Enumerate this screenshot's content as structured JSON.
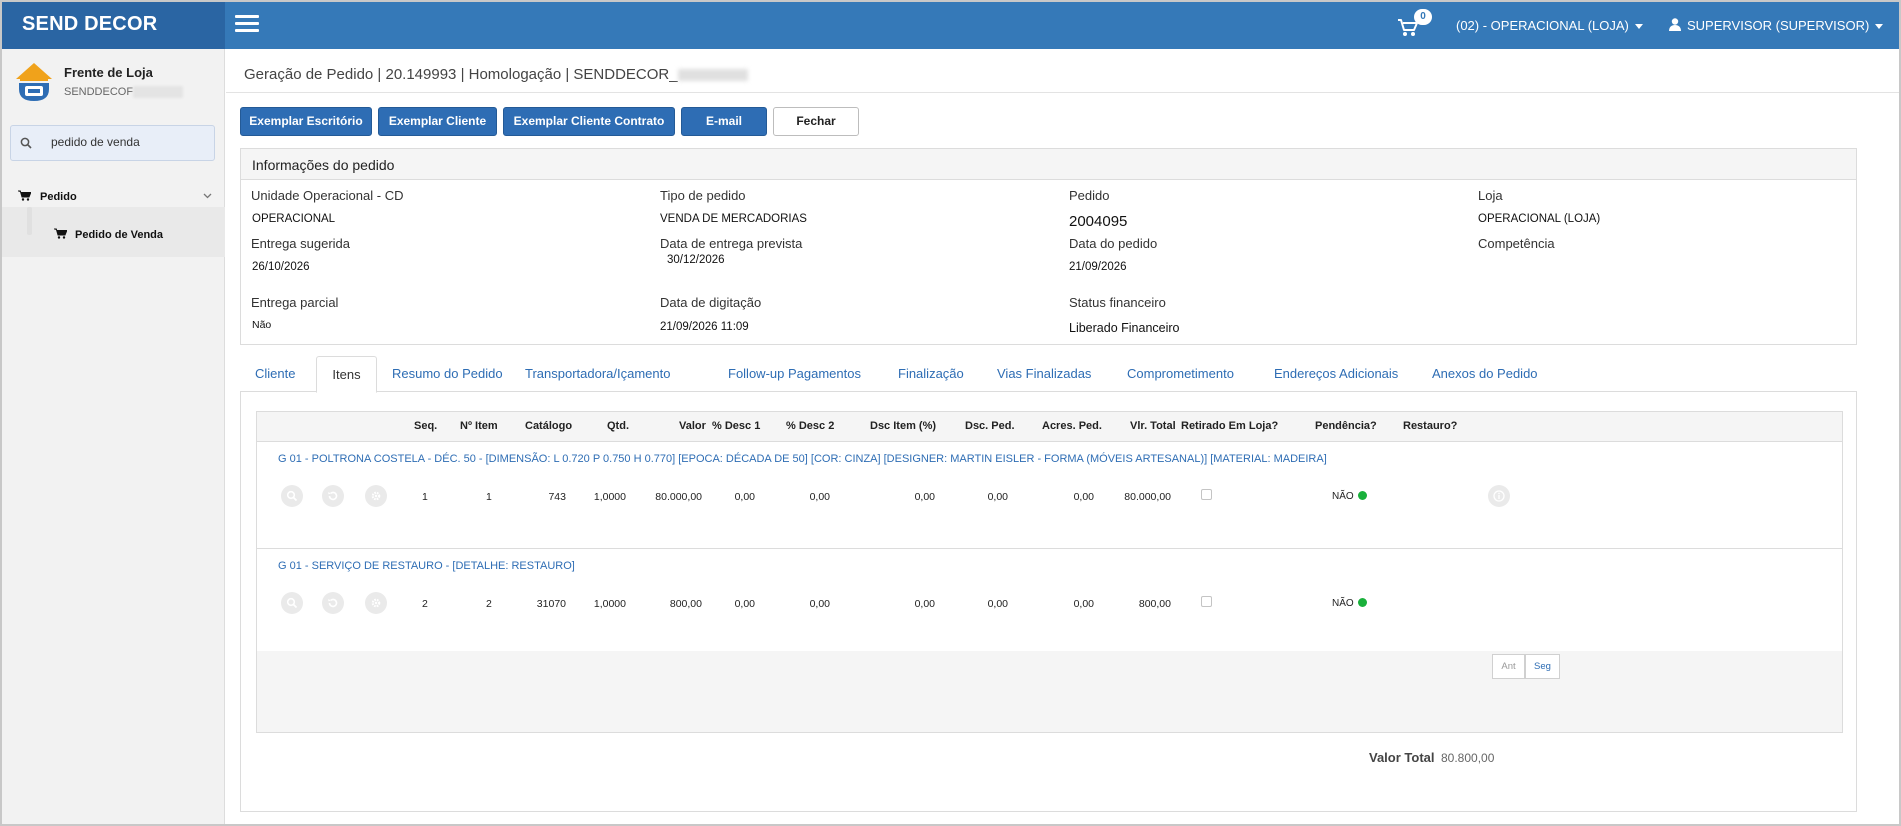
{
  "app": {
    "brand": "SEND DECOR"
  },
  "topbar": {
    "cart_count": "0",
    "unit_menu": "(02) - OPERACIONAL (LOJA)",
    "user_menu": "SUPERVISOR (SUPERVISOR)"
  },
  "sidebar": {
    "shop_title": "Frente de Loja",
    "shop_sub": "SENDDECOF",
    "search_value": "pedido de venda",
    "nav": [
      {
        "label": "Pedido"
      },
      {
        "label": "Pedido de Venda"
      }
    ]
  },
  "header": {
    "breadcrumb": "Geração de Pedido | 20.149993 | Homologação | SENDDECOR_"
  },
  "toolbar": {
    "btn_office": "Exemplar Escritório",
    "btn_client": "Exemplar Cliente",
    "btn_contract": "Exemplar Cliente Contrato",
    "btn_email": "E-mail",
    "btn_close": "Fechar"
  },
  "info": {
    "title": "Informações do pedido",
    "fields": [
      {
        "label": "Unidade Operacional - CD",
        "value": "OPERACIONAL"
      },
      {
        "label": "Tipo de pedido",
        "value": "VENDA DE MERCADORIAS"
      },
      {
        "label": "Pedido",
        "value": "2004095"
      },
      {
        "label": "Loja",
        "value": "OPERACIONAL (LOJA)"
      },
      {
        "label": "Entrega sugerida",
        "value": "26/10/2026"
      },
      {
        "label": "Data de entrega prevista",
        "value": "30/12/2026"
      },
      {
        "label": "Data do pedido",
        "value": "21/09/2026"
      },
      {
        "label": "Competência",
        "value": ""
      },
      {
        "label": "Entrega parcial",
        "value": "Não"
      },
      {
        "label": "Data de digitação",
        "value": "21/09/2026 11:09"
      },
      {
        "label": "Status financeiro",
        "value": "Liberado Financeiro"
      }
    ]
  },
  "tabs": [
    {
      "label": "Cliente"
    },
    {
      "label": "Itens"
    },
    {
      "label": "Resumo do Pedido"
    },
    {
      "label": "Transportadora/Içamento"
    },
    {
      "label": "Follow-up Pagamentos"
    },
    {
      "label": "Finalização"
    },
    {
      "label": "Vias Finalizadas"
    },
    {
      "label": "Comprometimento"
    },
    {
      "label": "Endereços Adicionais"
    },
    {
      "label": "Anexos do Pedido"
    }
  ],
  "grid": {
    "columns": [
      "Seq.",
      "Nº Item",
      "Catálogo",
      "Qtd.",
      "Valor",
      "% Desc 1",
      "% Desc 2",
      "Dsc Item (%)",
      "Dsc. Ped.",
      "Acres. Ped.",
      "Vlr. Total",
      "Retirado Em Loja?",
      "Pendência?",
      "Restauro?"
    ],
    "rows": [
      {
        "description": "G 01 - POLTRONA COSTELA - DÉC. 50 - [DIMENSÃO: L 0.720 P 0.750 H 0.770] [EPOCA: DÉCADA DE 50] [COR: CINZA] [DESIGNER: MARTIN EISLER - FORMA (MÓVEIS ARTESANAL)] [MATERIAL: MADEIRA]",
        "seq": "1",
        "item": "1",
        "catalog": "743",
        "qty": "1,0000",
        "value": "80.000,00",
        "desc1": "0,00",
        "desc2": "0,00",
        "dsc_item": "0,00",
        "dsc_ped": "0,00",
        "acres_ped": "0,00",
        "total": "80.000,00",
        "pendencia": "NÃO"
      },
      {
        "description": "G 01 - SERVIÇO DE RESTAURO - [DETALHE: RESTAURO]",
        "seq": "2",
        "item": "2",
        "catalog": "31070",
        "qty": "1,0000",
        "value": "800,00",
        "desc1": "0,00",
        "desc2": "0,00",
        "dsc_item": "0,00",
        "dsc_ped": "0,00",
        "acres_ped": "0,00",
        "total": "800,00",
        "pendencia": "NÃO"
      }
    ],
    "pager_prev": "Ant",
    "pager_next": "Seg"
  },
  "summary": {
    "total_label": "Valor Total",
    "total_value": "80.800,00"
  },
  "colors": {
    "primary": "#3579b8",
    "brand_dark": "#2a65a3",
    "button": "#2e6db4",
    "status_ok": "#19b03b"
  }
}
